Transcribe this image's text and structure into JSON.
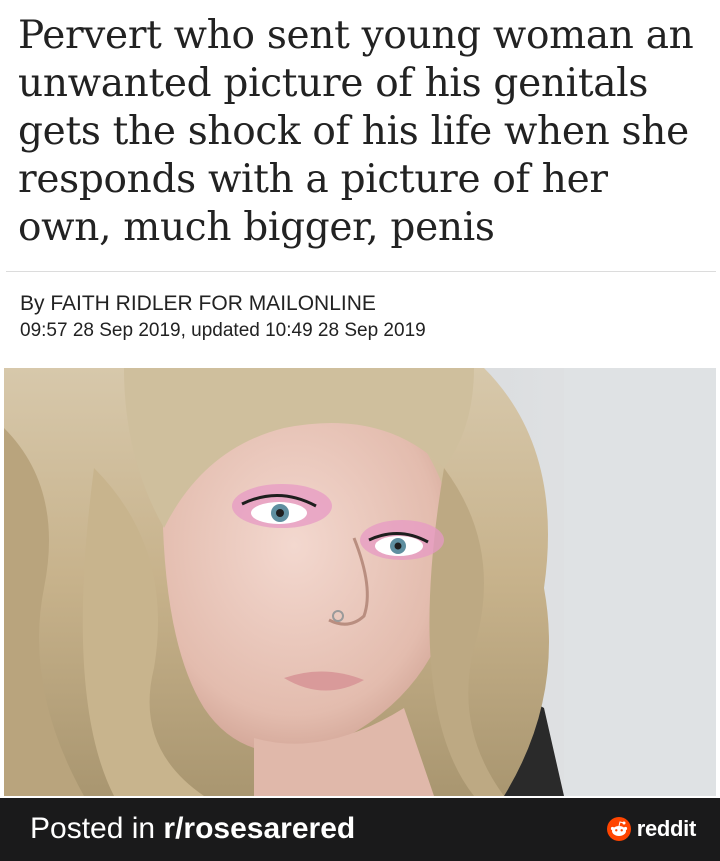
{
  "article": {
    "headline": "Pervert who sent young woman an unwanted picture of his genitals gets the shock of his life when she responds with a picture of her own, much bigger, penis",
    "byline": "By FAITH RIDLER FOR MAILONLINE",
    "timestamp": "09:57 28 Sep 2019, updated 10:49 28 Sep 2019",
    "photo_icon": "portrait-photo"
  },
  "footer": {
    "posted_prefix": "Posted in ",
    "subreddit": "r/rosesarered",
    "brand": "reddit",
    "brand_icon": "reddit-snoo-icon",
    "brand_color": "#ff4500"
  }
}
